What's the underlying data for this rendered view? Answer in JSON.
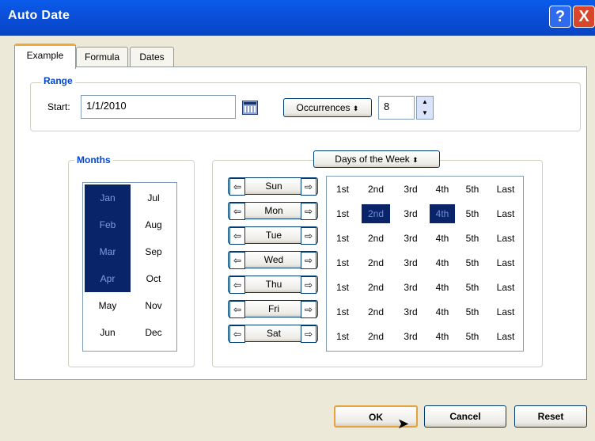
{
  "window": {
    "title": "Auto Date",
    "help": "?",
    "close": "X"
  },
  "tabs": [
    "Example",
    "Formula",
    "Dates"
  ],
  "range": {
    "legend": "Range",
    "start_label": "Start:",
    "start_value": "1/1/2010",
    "occurrences_label": "Occurrences",
    "occurrences_value": "8"
  },
  "months": {
    "legend": "Months",
    "items": [
      "Jan",
      "Feb",
      "Mar",
      "Apr",
      "May",
      "Jun",
      "Jul",
      "Aug",
      "Sep",
      "Oct",
      "Nov",
      "Dec"
    ],
    "selected": [
      "Jan",
      "Feb",
      "Mar",
      "Apr"
    ]
  },
  "days": {
    "selector_label": "Days of the Week",
    "names": [
      "Sun",
      "Mon",
      "Tue",
      "Wed",
      "Thu",
      "Fri",
      "Sat"
    ],
    "occurrence_labels": [
      "1st",
      "2nd",
      "3rd",
      "4th",
      "5th",
      "Last"
    ],
    "selected": {
      "Mon": [
        "2nd",
        "4th"
      ]
    }
  },
  "buttons": {
    "ok": "OK",
    "cancel": "Cancel",
    "reset": "Reset"
  }
}
